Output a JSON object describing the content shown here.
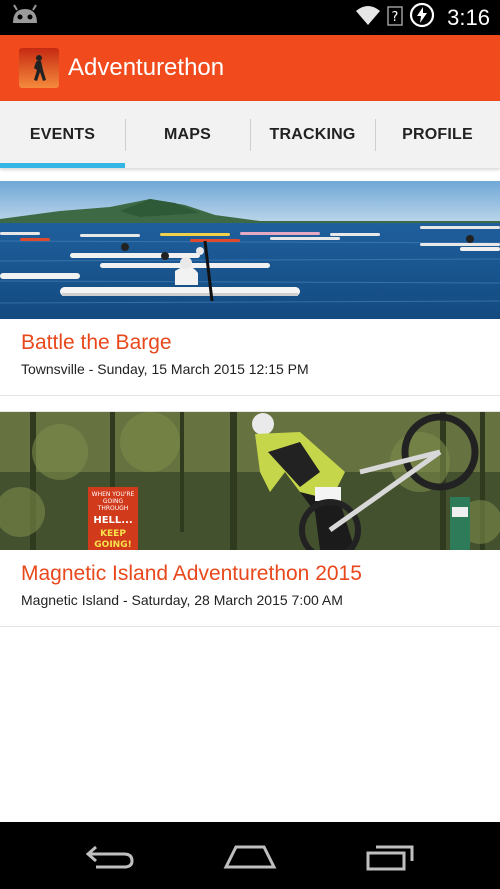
{
  "status_bar": {
    "time": "3:16",
    "icons": [
      "android-mascot-icon",
      "wifi-icon",
      "no-signal-icon",
      "battery-charging-icon"
    ]
  },
  "app_bar": {
    "title": "Adventurethon",
    "icon": "runner-app-icon",
    "color": "#f14b1d"
  },
  "tabs": [
    {
      "label": "EVENTS",
      "active": true
    },
    {
      "label": "MAPS",
      "active": false
    },
    {
      "label": "TRACKING",
      "active": false
    },
    {
      "label": "PROFILE",
      "active": false
    }
  ],
  "accent": "#33b5e5",
  "events": [
    {
      "title": "Battle the Barge",
      "subtitle": "Townsville - Sunday, 15 March 2015 12:15 PM",
      "image": "kayak-race-photo"
    },
    {
      "title": "Magnetic Island Adventurethon 2015",
      "subtitle": "Magnetic Island - Saturday, 28 March 2015 7:00 AM",
      "image": "mountain-bike-carry-photo",
      "sign_text": [
        "WHEN YOU'RE",
        "GOING",
        "THROUGH",
        "HELL...",
        "KEEP",
        "GOING!"
      ]
    }
  ],
  "nav_bar": {
    "icons": [
      "back-icon",
      "home-icon",
      "recents-icon"
    ]
  }
}
